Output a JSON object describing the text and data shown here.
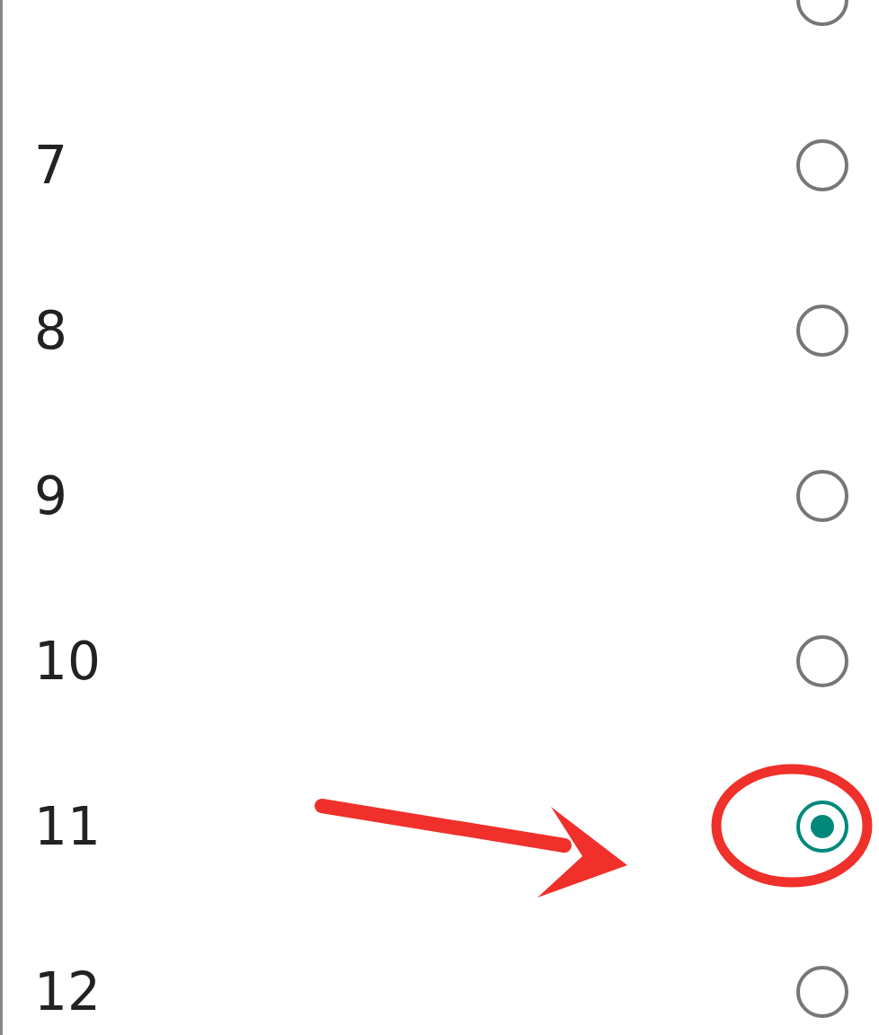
{
  "options": [
    {
      "selected": false
    },
    {
      "label": "7",
      "selected": false
    },
    {
      "label": "8",
      "selected": false
    },
    {
      "label": "9",
      "selected": false
    },
    {
      "label": "10",
      "selected": false
    },
    {
      "label": "11",
      "selected": true
    },
    {
      "label": "12",
      "selected": false
    }
  ]
}
